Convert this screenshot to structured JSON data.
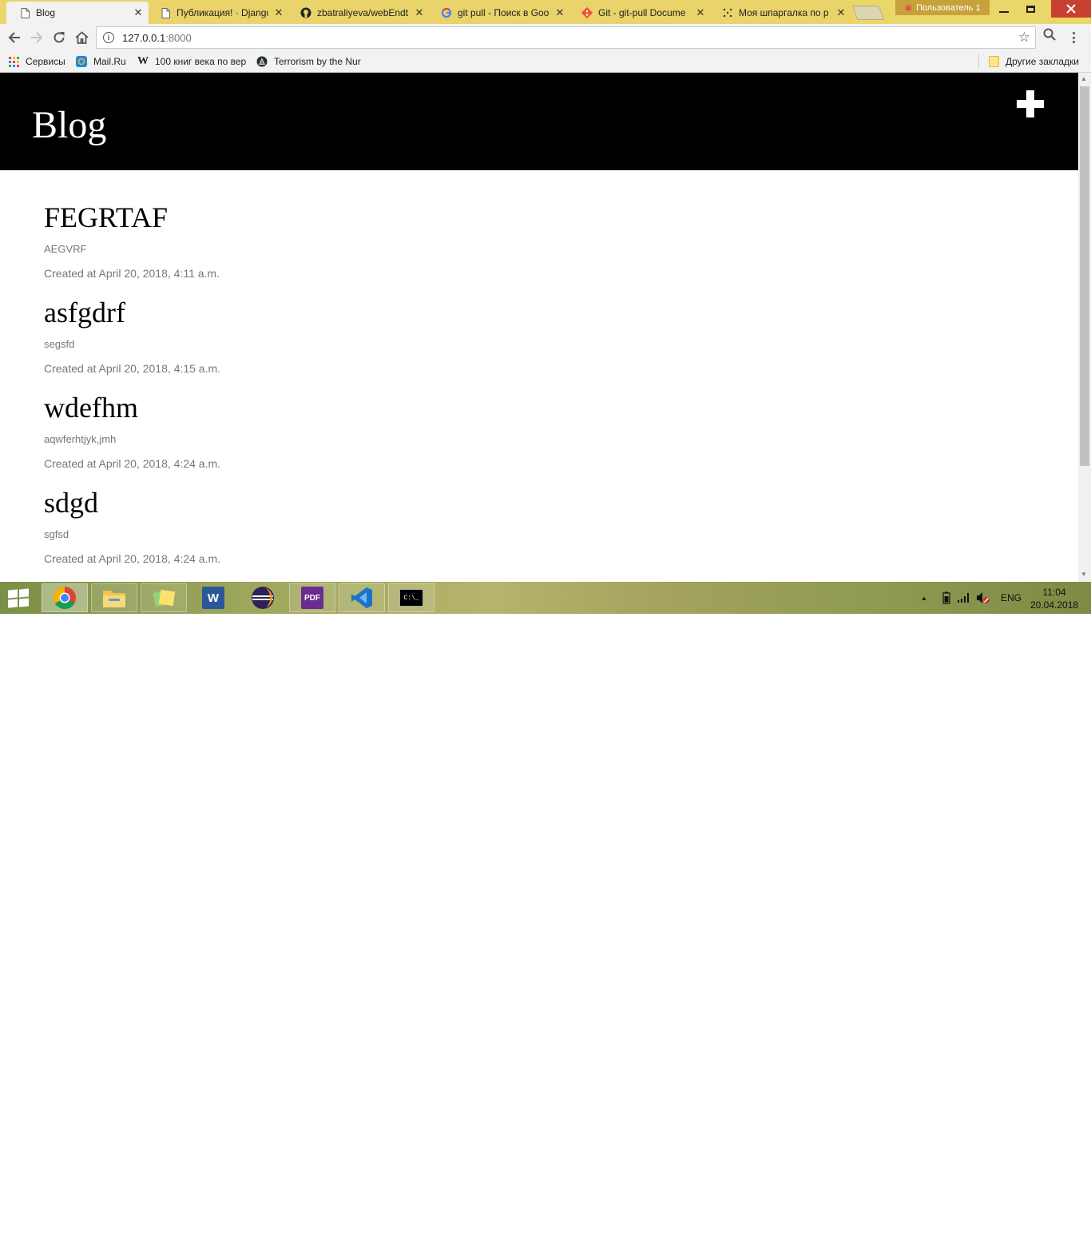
{
  "browser": {
    "tabs": [
      {
        "title": "Blog",
        "icon": "page-icon",
        "active": true
      },
      {
        "title": "Публикация! · Django",
        "icon": "page-icon",
        "active": false
      },
      {
        "title": "zbatraliyeva/webEndt",
        "icon": "github-icon",
        "active": false
      },
      {
        "title": "git pull - Поиск в Goo",
        "icon": "google-icon",
        "active": false
      },
      {
        "title": "Git - git-pull Docume",
        "icon": "git-icon",
        "active": false
      },
      {
        "title": "Моя шпаргалка по р",
        "icon": "dots-icon",
        "active": false
      }
    ],
    "tab_close_glyph": "✕",
    "user_profile": "Пользователь 1",
    "address": {
      "host": "127.0.0.1",
      "port": ":8000"
    },
    "bookmarks": [
      {
        "label": "Сервисы",
        "icon": "apps-grid-icon"
      },
      {
        "label": "Mail.Ru",
        "icon": "mailru-icon"
      },
      {
        "label": "100 книг века по вер",
        "icon": "wikipedia-icon"
      },
      {
        "label": "Terrorism by the Nur",
        "icon": "globe-icon"
      }
    ],
    "other_bookmarks": "Другие закладки"
  },
  "site": {
    "title": "Blog",
    "posts": [
      {
        "title": "FEGRTAF",
        "text": "AEGVRF",
        "date": "Created at April 20, 2018, 4:11 a.m."
      },
      {
        "title": "asfgdrf",
        "text": "segsfd",
        "date": "Created at April 20, 2018, 4:15 a.m."
      },
      {
        "title": "wdefhm",
        "text": "aqwferhtjyk,jmh",
        "date": "Created at April 20, 2018, 4:24 a.m."
      },
      {
        "title": "sdgd",
        "text": "sgfsd",
        "date": "Created at April 20, 2018, 4:24 a.m."
      }
    ]
  },
  "taskbar": {
    "apps": [
      {
        "name": "chrome",
        "icon": "chrome-icon",
        "active": true
      },
      {
        "name": "file-explorer",
        "icon": "folder-icon",
        "active": false
      },
      {
        "name": "sticky-notes",
        "icon": "sticky-notes-icon",
        "active": false
      },
      {
        "name": "word",
        "icon": "word-icon",
        "glyph": "W",
        "active": false
      },
      {
        "name": "eclipse",
        "icon": "eclipse-icon",
        "active": false
      },
      {
        "name": "pdf-reader",
        "icon": "pdf-icon",
        "glyph": "PDF",
        "active": false
      },
      {
        "name": "vscode",
        "icon": "vscode-icon",
        "active": false
      },
      {
        "name": "command-prompt",
        "icon": "cmd-icon",
        "glyph": "C:\\_",
        "active": false
      }
    ],
    "language": "ENG",
    "time": "11:04",
    "date": "20.04.2018"
  },
  "colors": {
    "header_bg": "#000000",
    "chrome_titlebar": "#ead76a",
    "muted_text": "#777777",
    "close_button": "#c84031"
  }
}
